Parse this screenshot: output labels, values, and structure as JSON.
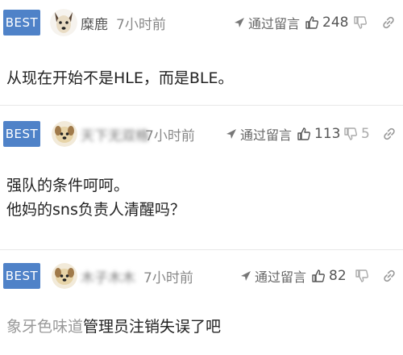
{
  "comments": [
    {
      "badge": "BEST",
      "user": "糜鹿",
      "time": "7小时前",
      "via": "通过留言",
      "likes": "248",
      "dislikes": "",
      "body": [
        "从现在开始不是HLE，而是BLE。"
      ]
    },
    {
      "badge": "BEST",
      "user": "天下无双格",
      "time": "7小时前",
      "via": "通过留言",
      "likes": "113",
      "dislikes": "5",
      "body": [
        "强队的条件呵呵。",
        "他妈的sns负责人清醒吗？"
      ]
    },
    {
      "badge": "BEST",
      "user": "木子木木",
      "time": "7小时前",
      "via": "通过留言",
      "likes": "82",
      "dislikes": "",
      "quote": "象牙色味道",
      "body": [
        "管理员注销失误了吧"
      ]
    }
  ],
  "colors": {
    "badge": "#4f82c8",
    "divider": "#e8e8e8"
  },
  "icons": {
    "via": "send-arrow-icon",
    "like": "thumbs-up-icon",
    "dislike": "thumbs-down-icon",
    "link": "link-icon"
  }
}
